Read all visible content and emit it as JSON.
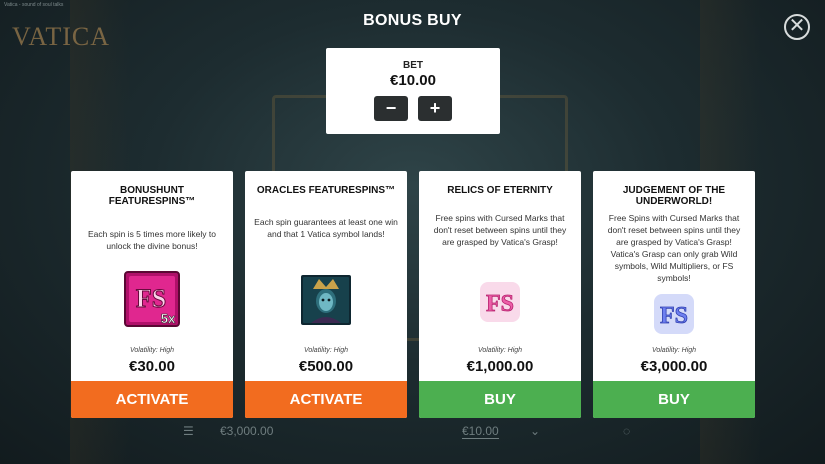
{
  "header": {
    "title": "BONUS BUY",
    "close_glyph": "✕",
    "logo": "VATICA",
    "small_text": "Vatica - sound of soul talks"
  },
  "bet": {
    "label": "BET",
    "value": "€10.00",
    "minus": "−",
    "plus": "+"
  },
  "cards": [
    {
      "title": "BONUSHUNT FEATURESPINS™",
      "description": "Each spin is 5 times more likely to unlock the divine bonus!",
      "icon": "fs-5x-icon",
      "icon_text": "FS",
      "icon_sub": "5x",
      "volatility": "Volatility: High",
      "price": "€30.00",
      "action": "ACTIVATE",
      "action_color": "#f26c1f"
    },
    {
      "title": "ORACLES FEATURESPINS™",
      "description": "Each spin guarantees at least one win and that 1 Vatica symbol lands!",
      "icon": "vatica-portrait-icon",
      "volatility": "Volatility: High",
      "price": "€500.00",
      "action": "ACTIVATE",
      "action_color": "#f26c1f"
    },
    {
      "title": "RELICS OF ETERNITY",
      "description": "Free spins with Cursed Marks that don't reset between spins until they are grasped by Vatica's Grasp!",
      "icon": "fs-pink-icon",
      "icon_text": "FS",
      "volatility": "Volatility: High",
      "price": "€1,000.00",
      "action": "BUY",
      "action_color": "#4caf50"
    },
    {
      "title": "JUDGEMENT OF THE UNDERWORLD!",
      "description": "Free Spins with Cursed Marks that don't reset between spins until they are grasped by Vatica's Grasp! Vatica's Grasp can only grab Wild symbols, Wild Multipliers, or FS symbols!",
      "icon": "fs-blue-icon",
      "icon_text": "FS",
      "volatility": "Volatility: High",
      "price": "€3,000.00",
      "action": "BUY",
      "action_color": "#4caf50"
    }
  ],
  "bottom": {
    "balance": "€3,000.00",
    "bet": "€10.00"
  }
}
